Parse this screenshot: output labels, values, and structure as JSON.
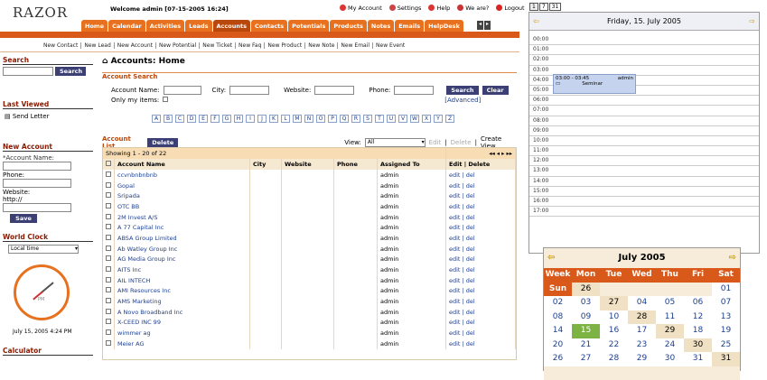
{
  "app": {
    "logo": "RAZOR",
    "welcome": "Welcome admin  [07-15-2005 16:24]"
  },
  "toplinks": [
    "My Account",
    "Settings",
    "Help",
    "We are?",
    "Logout"
  ],
  "tabs": [
    "Home",
    "Calendar",
    "Activities",
    "Leads",
    "Accounts",
    "Contacts",
    "Potentials",
    "Products",
    "Notes",
    "Emails",
    "HelpDesk"
  ],
  "selected_tab": "Accounts",
  "sublinks": [
    "New Contact",
    "New Lead",
    "New Account",
    "New Potential",
    "New Ticket",
    "New Faq",
    "New Product",
    "New Note",
    "New Email",
    "New Event"
  ],
  "sidebar": {
    "search_title": "Search",
    "search_btn": "Search",
    "last_viewed_title": "Last Viewed",
    "last_viewed_item": "Send Letter",
    "new_account_title": "New Account",
    "account_name_label": "*Account Name:",
    "phone_label": "Phone:",
    "website_label": "Website:",
    "website_value": "http://",
    "save_btn": "Save",
    "world_clock_title": "World Clock",
    "timezone": "Local time",
    "clock_label": "PM",
    "clock_time": "July 15, 2005 4:24 PM",
    "calculator_title": "Calculator"
  },
  "main": {
    "title": "Accounts: Home",
    "search_title": "Account Search",
    "fields": {
      "account_name": "Account Name:",
      "city": "City:",
      "website": "Website:",
      "phone": "Phone:",
      "only_my": "Only my items:"
    },
    "search_btn": "Search",
    "clear_btn": "Clear",
    "advanced": "[Advanced]",
    "letters": [
      "A",
      "B",
      "C",
      "D",
      "E",
      "F",
      "G",
      "H",
      "I",
      "J",
      "K",
      "L",
      "M",
      "N",
      "O",
      "P",
      "Q",
      "R",
      "S",
      "T",
      "U",
      "V",
      "W",
      "X",
      "Y",
      "Z"
    ],
    "list_title": "Account List",
    "delete_btn": "Delete",
    "view_label": "View:",
    "view_value": "All",
    "edit_link": "Edit",
    "delete_link": "Delete",
    "create_view": "Create View",
    "showing": "Showing 1 - 20 of 22",
    "columns": [
      "Account Name",
      "City",
      "Website",
      "Phone",
      "Assigned To",
      "Edit | Delete"
    ],
    "rows": [
      "ccvnbnbnbnb",
      "Gopal",
      "Sripada",
      "OTC BB",
      "2M Invest A/S",
      "A 77 Capital Inc",
      "ABSA Group Limited",
      "Ab Watley Group Inc",
      "AG Media Group Inc",
      "AITS Inc",
      "AIL INTECH",
      "AMI Resources Inc",
      "AMS Marketing",
      "A Novo Broadband Inc",
      "X-CEED INC 99",
      "wimmer ag",
      "Meier AG"
    ],
    "assigned": "admin",
    "edit_del": "edit | del"
  },
  "calendar": {
    "view_buttons": [
      "1",
      "7",
      "31"
    ],
    "day_title": "Friday, 15. July 2005",
    "hours": [
      "00:00",
      "01:00",
      "02:00",
      "03:00",
      "04:00",
      "05:00",
      "06:00",
      "07:00",
      "08:00",
      "09:00",
      "10:00",
      "11:00",
      "12:00",
      "13:00",
      "14:00",
      "15:00",
      "16:00",
      "17:00"
    ],
    "event": {
      "time": "03:00 - 03:45",
      "owner": "admin",
      "title": "Seminar"
    },
    "month_title": "July 2005",
    "weekdays": [
      "Week",
      "Mon",
      "Tue",
      "Wed",
      "Thu",
      "Fri",
      "Sat",
      "Sun"
    ],
    "weeks": [
      [
        "26",
        "",
        "",
        "",
        "",
        "01",
        "02",
        "03"
      ],
      [
        "27",
        "04",
        "05",
        "06",
        "07",
        "08",
        "09",
        "10"
      ],
      [
        "28",
        "11",
        "12",
        "13",
        "14",
        "15",
        "16",
        "17"
      ],
      [
        "29",
        "18",
        "19",
        "20",
        "21",
        "22",
        "23",
        "24"
      ],
      [
        "30",
        "25",
        "26",
        "27",
        "28",
        "29",
        "30",
        "31"
      ],
      [
        "31",
        "",
        "",
        "",
        "",
        "",
        "",
        ""
      ]
    ],
    "today": "15"
  }
}
